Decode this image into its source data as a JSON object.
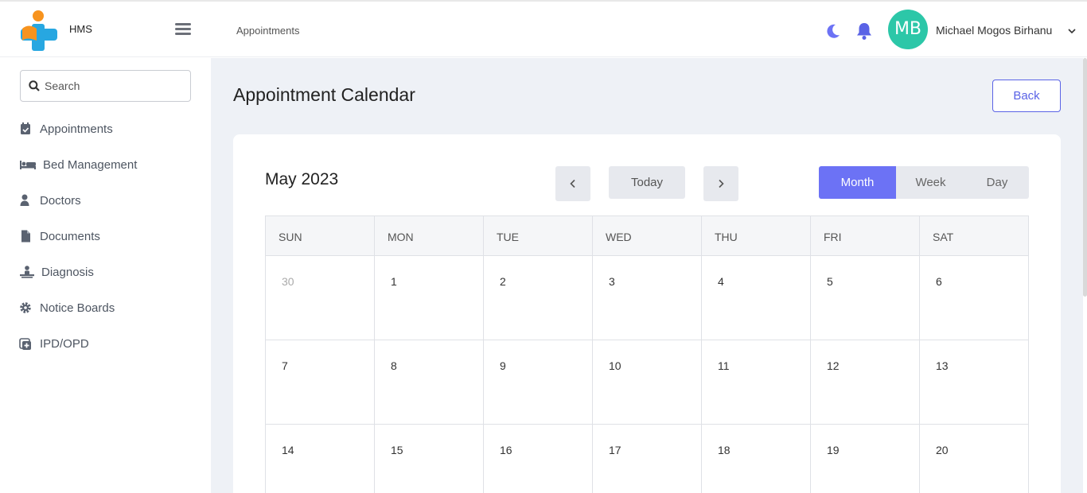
{
  "app": {
    "name": "HMS",
    "breadcrumb": "Appointments"
  },
  "user": {
    "initials": "MB",
    "name": "Michael Mogos Birhanu",
    "avatar_color": "#2cc7a8"
  },
  "search": {
    "placeholder": "Search"
  },
  "sidebar": {
    "items": [
      {
        "label": "Appointments",
        "icon": "calendar-check-icon"
      },
      {
        "label": "Bed Management",
        "icon": "bed-icon"
      },
      {
        "label": "Doctors",
        "icon": "user-doctor-icon"
      },
      {
        "label": "Documents",
        "icon": "file-icon"
      },
      {
        "label": "Diagnosis",
        "icon": "diagnosis-icon"
      },
      {
        "label": "Notice Boards",
        "icon": "gear-icon"
      },
      {
        "label": "IPD/OPD",
        "icon": "hospital-plus-icon"
      }
    ]
  },
  "main": {
    "title": "Appointment Calendar",
    "back_label": "Back"
  },
  "calendar": {
    "title": "May 2023",
    "today_label": "Today",
    "views": [
      "Month",
      "Week",
      "Day"
    ],
    "active_view": "Month",
    "weekdays": [
      "SUN",
      "MON",
      "TUE",
      "WED",
      "THU",
      "FRI",
      "SAT"
    ],
    "weeks": [
      [
        "30",
        "1",
        "2",
        "3",
        "4",
        "5",
        "6"
      ],
      [
        "7",
        "8",
        "9",
        "10",
        "11",
        "12",
        "13"
      ],
      [
        "14",
        "15",
        "16",
        "17",
        "18",
        "19",
        "20"
      ]
    ]
  },
  "colors": {
    "accent": "#6c72f5",
    "back_border": "#5a63e6",
    "background": "#eef1f6",
    "bell": "#5a63e6"
  }
}
